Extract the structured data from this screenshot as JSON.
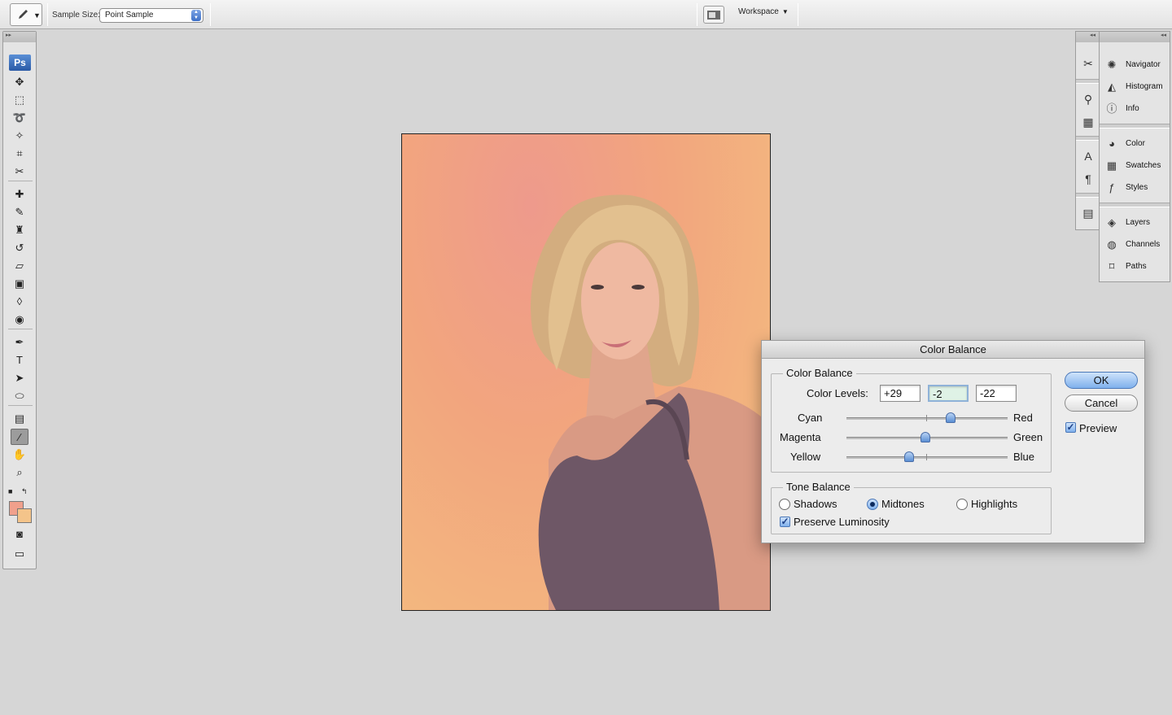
{
  "options_bar": {
    "sample_size_label": "Sample Size:",
    "sample_size_value": "Point Sample",
    "workspace_label": "Workspace"
  },
  "tools": {
    "logo": "Ps",
    "items": [
      {
        "name": "move-tool",
        "glyph": "✥"
      },
      {
        "name": "marquee-tool",
        "glyph": "⬚"
      },
      {
        "name": "lasso-tool",
        "glyph": "➰"
      },
      {
        "name": "magic-wand-tool",
        "glyph": "✧"
      },
      {
        "name": "crop-tool",
        "glyph": "⌗"
      },
      {
        "name": "slice-tool",
        "glyph": "✂"
      },
      {
        "name": "healing-brush-tool",
        "glyph": "✚"
      },
      {
        "name": "brush-tool",
        "glyph": "✎"
      },
      {
        "name": "clone-stamp-tool",
        "glyph": "♜"
      },
      {
        "name": "history-brush-tool",
        "glyph": "↺"
      },
      {
        "name": "eraser-tool",
        "glyph": "▱"
      },
      {
        "name": "gradient-tool",
        "glyph": "▣"
      },
      {
        "name": "blur-tool",
        "glyph": "◊"
      },
      {
        "name": "dodge-tool",
        "glyph": "◉"
      },
      {
        "name": "pen-tool",
        "glyph": "✒"
      },
      {
        "name": "type-tool",
        "glyph": "T"
      },
      {
        "name": "path-selection-tool",
        "glyph": "➤"
      },
      {
        "name": "shape-tool",
        "glyph": "⬭"
      },
      {
        "name": "notes-tool",
        "glyph": "▤"
      },
      {
        "name": "eyedropper-tool",
        "glyph": "⁄"
      },
      {
        "name": "hand-tool",
        "glyph": "✋"
      },
      {
        "name": "zoom-tool",
        "glyph": "⌕"
      }
    ],
    "foreground_color": "#f0a08c",
    "background_color": "#f4c48a"
  },
  "panels": {
    "icon_column": [
      {
        "name": "tool-presets-icon",
        "glyph": "✂"
      },
      {
        "name": "brushes-icon",
        "glyph": "⚲"
      },
      {
        "name": "clone-source-icon",
        "glyph": "▦"
      },
      {
        "name": "character-icon",
        "glyph": "A"
      },
      {
        "name": "paragraph-icon",
        "glyph": "¶"
      },
      {
        "name": "layer-comps-icon",
        "glyph": "▤"
      }
    ],
    "group1": [
      {
        "label": "Navigator",
        "icon": "navigator-icon",
        "glyph": "✺"
      },
      {
        "label": "Histogram",
        "icon": "histogram-icon",
        "glyph": "◭"
      },
      {
        "label": "Info",
        "icon": "info-icon",
        "glyph": "ⓘ"
      }
    ],
    "group2": [
      {
        "label": "Color",
        "icon": "color-icon",
        "glyph": "◕"
      },
      {
        "label": "Swatches",
        "icon": "swatches-icon",
        "glyph": "▦"
      },
      {
        "label": "Styles",
        "icon": "styles-icon",
        "glyph": "ƒ"
      }
    ],
    "group3": [
      {
        "label": "Layers",
        "icon": "layers-icon",
        "glyph": "◈"
      },
      {
        "label": "Channels",
        "icon": "channels-icon",
        "glyph": "◍"
      },
      {
        "label": "Paths",
        "icon": "paths-icon",
        "glyph": "⌑"
      }
    ]
  },
  "dialog": {
    "title": "Color Balance",
    "color_balance_group": "Color Balance",
    "color_levels_label": "Color Levels:",
    "levels": [
      "+29",
      "-2",
      "-22"
    ],
    "sliders": [
      {
        "left": "Cyan",
        "right": "Red",
        "value": 29
      },
      {
        "left": "Magenta",
        "right": "Green",
        "value": -2
      },
      {
        "left": "Yellow",
        "right": "Blue",
        "value": -22
      }
    ],
    "slider_range": [
      -100,
      100
    ],
    "tone_balance_group": "Tone Balance",
    "tones": {
      "shadows": "Shadows",
      "midtones": "Midtones",
      "highlights": "Highlights",
      "selected": "Midtones"
    },
    "preserve_luminosity": "Preserve Luminosity",
    "preserve_luminosity_checked": true,
    "ok": "OK",
    "cancel": "Cancel",
    "preview": "Preview",
    "preview_checked": true
  }
}
